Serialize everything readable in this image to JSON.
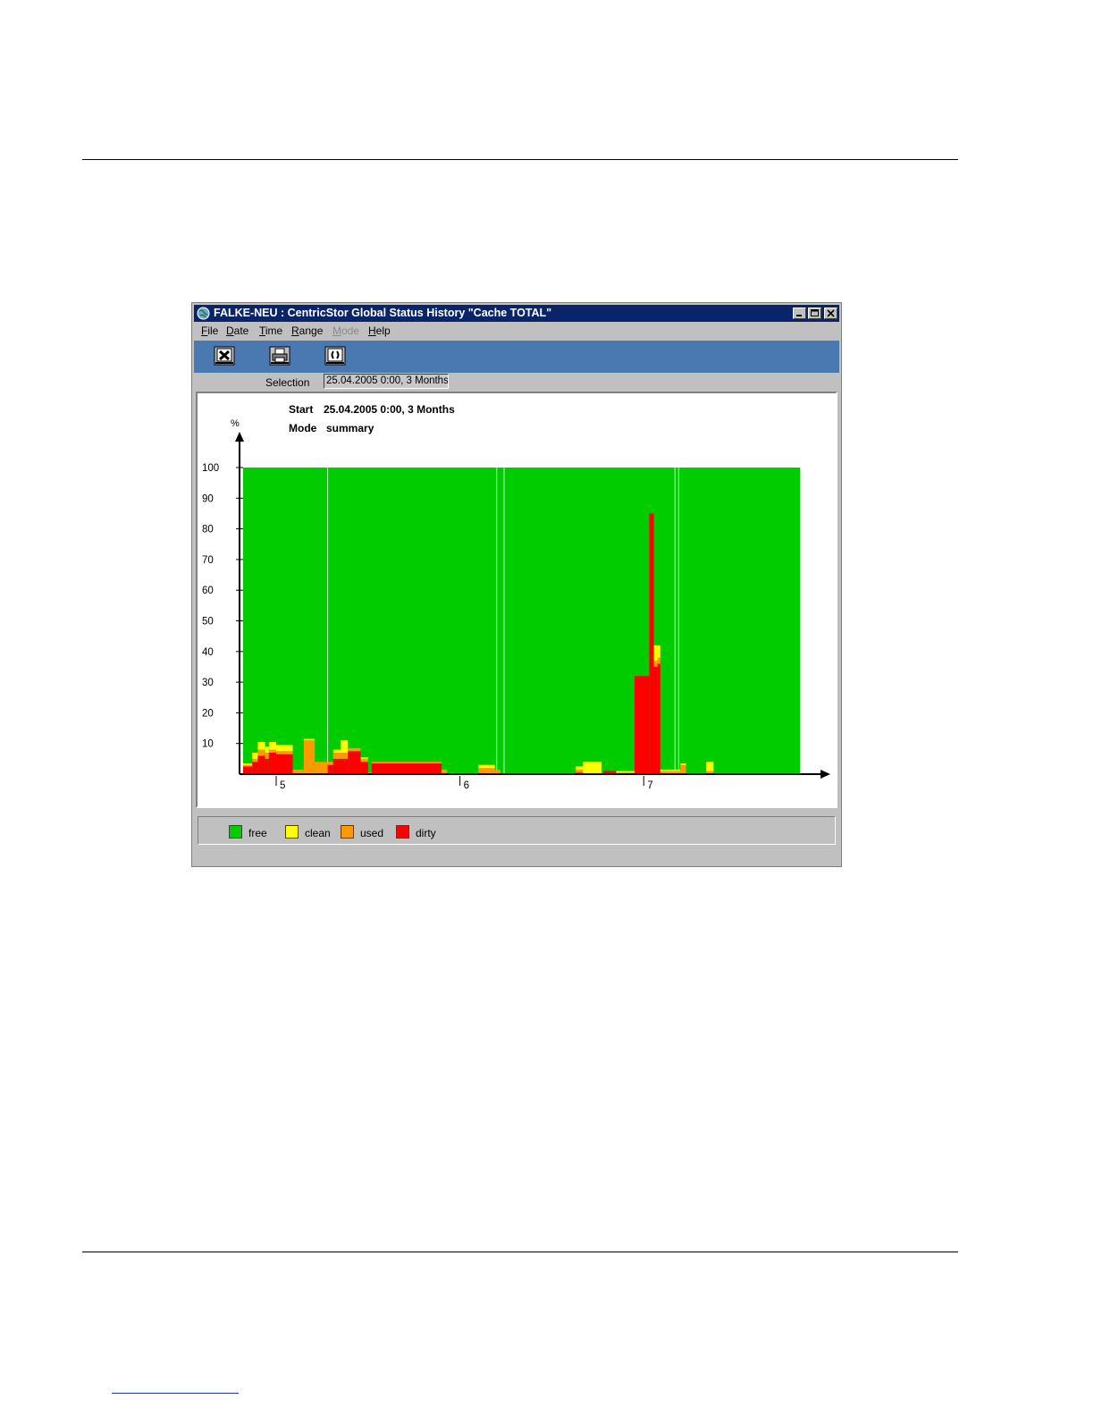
{
  "window": {
    "title": "FALKE-NEU : CentricStor Global Status History \"Cache TOTAL\""
  },
  "menu": [
    {
      "label": "File",
      "underline": "F",
      "rest": "ile",
      "enabled": true
    },
    {
      "label": "Date",
      "underline": "D",
      "rest": "ate",
      "enabled": true
    },
    {
      "label": "Time",
      "underline": "T",
      "rest": "ime",
      "enabled": true
    },
    {
      "label": "Range",
      "underline": "R",
      "rest": "ange",
      "enabled": true
    },
    {
      "label": "Mode",
      "underline": "M",
      "rest": "ode",
      "enabled": false
    },
    {
      "label": "Help",
      "underline": "H",
      "rest": "elp",
      "enabled": true
    }
  ],
  "toolbar": {
    "icons": [
      "close-icon",
      "print-icon",
      "refresh-icon"
    ]
  },
  "selection": {
    "label": "Selection",
    "value": "25.04.2005  0:00, 3 Months"
  },
  "chart_data": {
    "type": "area",
    "header": {
      "start_label": "Start",
      "start_value": "25.04.2005  0:00, 3 Months",
      "mode_label": "Mode",
      "mode_value": "summary"
    },
    "ylabel": "%",
    "ylim": [
      0,
      100
    ],
    "yticks": [
      10,
      20,
      30,
      40,
      50,
      60,
      70,
      80,
      90,
      100
    ],
    "xlim": [
      4.82,
      7.85
    ],
    "xticks": [
      5,
      6,
      7
    ],
    "legend_position": "bottom",
    "colors": {
      "free": "#00cc00",
      "clean": "#ffff00",
      "used": "#ff9900",
      "dirty": "#ff0000"
    },
    "series_order": [
      "dirty",
      "used",
      "clean",
      "free"
    ],
    "series": [
      {
        "name": "free",
        "color": "#00cc00"
      },
      {
        "name": "clean",
        "color": "#ffff00"
      },
      {
        "name": "used",
        "color": "#ff9900"
      },
      {
        "name": "dirty",
        "color": "#ff0000"
      }
    ],
    "segments": [
      {
        "x0": 4.82,
        "x1": 4.87,
        "dirty": 2.5,
        "used": 0.5,
        "clean": 0.5
      },
      {
        "x0": 4.87,
        "x1": 4.9,
        "dirty": 4,
        "used": 1,
        "clean": 2
      },
      {
        "x0": 4.9,
        "x1": 4.94,
        "dirty": 6,
        "used": 2,
        "clean": 2.5
      },
      {
        "x0": 4.94,
        "x1": 4.96,
        "dirty": 5,
        "used": 2,
        "clean": 2
      },
      {
        "x0": 4.96,
        "x1": 5.0,
        "dirty": 7,
        "used": 1,
        "clean": 2.5
      },
      {
        "x0": 5.0,
        "x1": 5.09,
        "dirty": 6.5,
        "used": 1,
        "clean": 2
      },
      {
        "x0": 5.09,
        "x1": 5.15,
        "dirty": 0,
        "used": 1.5,
        "clean": 0
      },
      {
        "x0": 5.15,
        "x1": 5.21,
        "dirty": 0,
        "used": 11,
        "clean": 0.5
      },
      {
        "x0": 5.21,
        "x1": 5.28,
        "dirty": 0,
        "used": 4,
        "clean": 0
      },
      {
        "x0": 5.28,
        "x1": 5.31,
        "dirty": 3,
        "used": 1,
        "clean": 0
      },
      {
        "x0": 5.31,
        "x1": 5.35,
        "dirty": 5,
        "used": 2,
        "clean": 1
      },
      {
        "x0": 5.35,
        "x1": 5.39,
        "dirty": 5,
        "used": 2,
        "clean": 4
      },
      {
        "x0": 5.39,
        "x1": 5.46,
        "dirty": 7.5,
        "used": 1,
        "clean": 0
      },
      {
        "x0": 5.46,
        "x1": 5.5,
        "dirty": 4,
        "used": 1,
        "clean": 0.5
      },
      {
        "x0": 5.5,
        "x1": 5.52,
        "dirty": 0,
        "used": 0.5,
        "clean": 0
      },
      {
        "x0": 5.52,
        "x1": 5.9,
        "dirty": 3.5,
        "used": 0.5,
        "clean": 0
      },
      {
        "x0": 5.9,
        "x1": 5.93,
        "dirty": 0,
        "used": 1.5,
        "clean": 0
      },
      {
        "x0": 6.1,
        "x1": 6.19,
        "dirty": 0,
        "used": 2,
        "clean": 1
      },
      {
        "x0": 6.19,
        "x1": 6.22,
        "dirty": 0,
        "used": 1.5,
        "clean": 0
      },
      {
        "x0": 6.63,
        "x1": 6.67,
        "dirty": 0.5,
        "used": 1,
        "clean": 1
      },
      {
        "x0": 6.67,
        "x1": 6.77,
        "dirty": 0,
        "used": 0,
        "clean": 4
      },
      {
        "x0": 6.78,
        "x1": 6.85,
        "dirty": 1,
        "used": 0,
        "clean": 0
      },
      {
        "x0": 6.85,
        "x1": 6.95,
        "dirty": 0,
        "used": 0.5,
        "clean": 0.5
      },
      {
        "x0": 6.95,
        "x1": 7.03,
        "dirty": 32,
        "used": 0,
        "clean": 0
      },
      {
        "x0": 7.03,
        "x1": 7.055,
        "dirty": 85,
        "used": 0,
        "clean": 0
      },
      {
        "x0": 7.055,
        "x1": 7.075,
        "dirty": 35,
        "used": 2,
        "clean": 5
      },
      {
        "x0": 7.075,
        "x1": 7.09,
        "dirty": 36,
        "used": 2,
        "clean": 4
      },
      {
        "x0": 7.09,
        "x1": 7.2,
        "dirty": 0,
        "used": 1,
        "clean": 0.5
      },
      {
        "x0": 7.2,
        "x1": 7.23,
        "dirty": 0,
        "used": 3,
        "clean": 0.5
      },
      {
        "x0": 7.34,
        "x1": 7.38,
        "dirty": 0,
        "used": 1,
        "clean": 3
      }
    ]
  },
  "legend": [
    {
      "label": "free",
      "color": "#00cc00"
    },
    {
      "label": "clean",
      "color": "#ffff00"
    },
    {
      "label": "used",
      "color": "#ff9900"
    },
    {
      "label": "dirty",
      "color": "#ff0000"
    }
  ]
}
